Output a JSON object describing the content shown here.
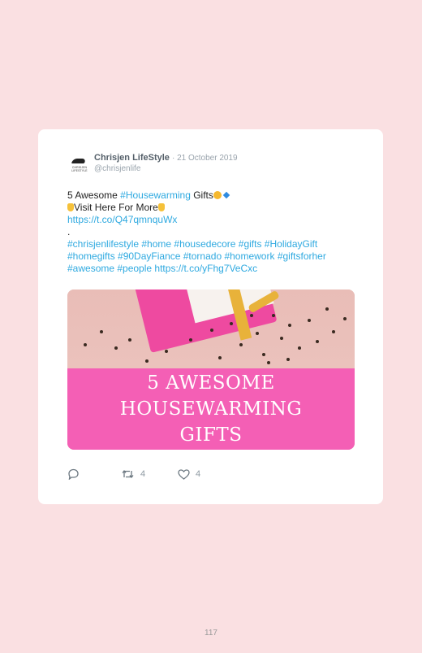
{
  "tweet": {
    "author_name": "Chrisjen LifeStyle",
    "date": "21 October 2019",
    "handle": "@chrisjenlife",
    "avatar_text": "CHRISJEN LIFESTYLE",
    "line1_prefix": "5 Awesome ",
    "line1_tag": "#Housewarming",
    "line1_suffix": " Gifts",
    "line2": "Visit Here For More",
    "link1": "https://t.co/Q47qmnquWx",
    "dot": ".",
    "hashtags_line1": "#chrisjenlifestyle #home #housedecore #gifts #HolidayGift",
    "hashtags_line2": "#homegifts #90DayFiance #tornado #homework #giftsforher",
    "hashtags_line3_tags": "#awesome #people",
    "link2": "https://t.co/yFhg7VeCxc",
    "media": {
      "title_line1": "5 AWESOME",
      "title_line2": "HOUSEWARMING",
      "title_line3": "GIFTS"
    },
    "actions": {
      "reply_icon": "reply-icon",
      "retweet_icon": "retweet-icon",
      "like_icon": "heart-icon",
      "retweet_count": "4",
      "like_count": "4"
    }
  },
  "page_number": "117",
  "colors": {
    "background": "#fae0e2",
    "link": "#2ea9e0",
    "banner": "#f45fb5"
  }
}
